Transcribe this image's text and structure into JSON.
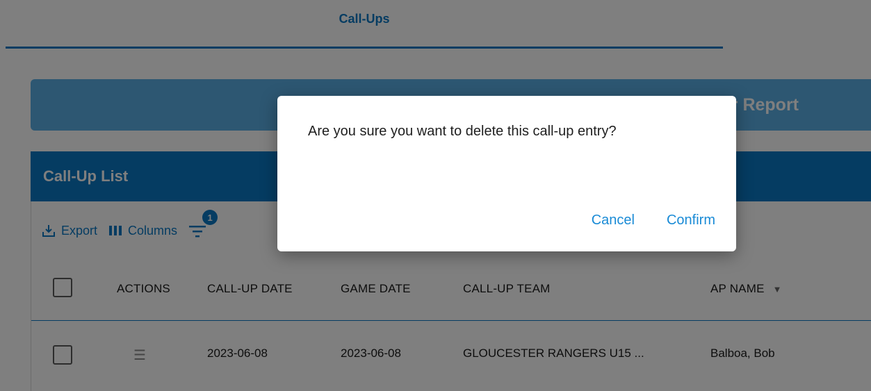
{
  "tabs": [
    {
      "label": "Call-Ups"
    }
  ],
  "banner": {
    "label": "ner Report"
  },
  "list": {
    "title": "Call-Up List",
    "toolbar": {
      "export_label": "Export",
      "columns_label": "Columns",
      "filter_count": "1"
    },
    "columns": [
      "ACTIONS",
      "CALL-UP DATE",
      "GAME DATE",
      "CALL-UP TEAM",
      "AP NAME"
    ],
    "rows": [
      {
        "call_up_date": "2023-06-08",
        "game_date": "2023-06-08",
        "call_up_team": "GLOUCESTER RANGERS U15 ...",
        "ap_name": "Balboa, Bob"
      }
    ]
  },
  "dialog": {
    "message": "Are you sure you want to delete this call-up entry?",
    "cancel_label": "Cancel",
    "confirm_label": "Confirm"
  },
  "colors": {
    "primary": "#0b78c4",
    "banner": "#5aaee5",
    "dialog_button": "#1a8bd6",
    "overlay": "rgba(0,0,0,0.5)"
  }
}
